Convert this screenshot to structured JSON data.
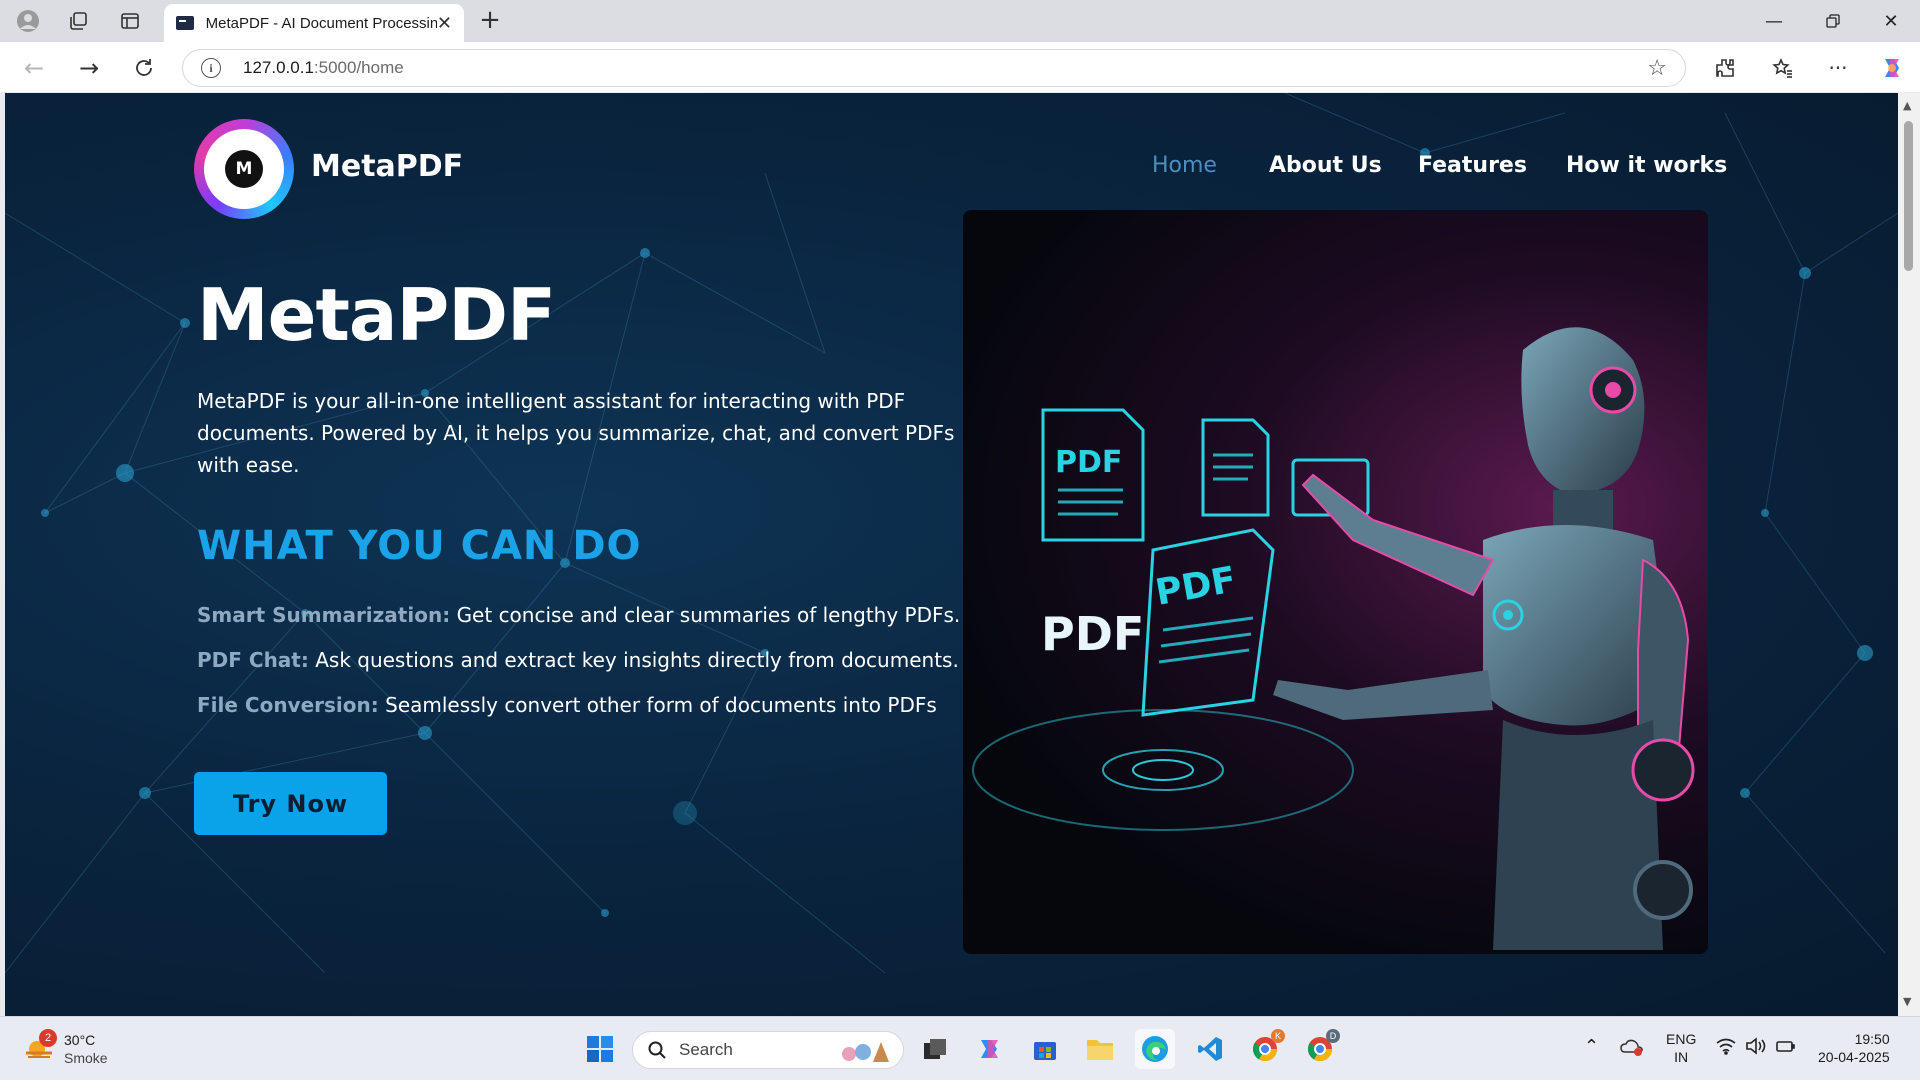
{
  "browser": {
    "tab_title": "MetaPDF - AI Document Processing",
    "url_host": "127.0.0.1",
    "url_path": ":5000/home"
  },
  "site": {
    "brand": "MetaPDF",
    "logo_letter": "M",
    "nav": [
      {
        "label": "Home",
        "active": true
      },
      {
        "label": "About Us",
        "active": false
      },
      {
        "label": "Features",
        "active": false
      },
      {
        "label": "How it works",
        "active": false
      }
    ],
    "hero_title": "MetaPDF",
    "hero_description": "MetaPDF is your all-in-one intelligent assistant for interacting with PDF documents. Powered by AI, it helps you summarize, chat, and convert PDFs with ease.",
    "section_heading": "WHAT YOU CAN DO",
    "features": [
      {
        "label": "Smart Summarization:",
        "text": "Get concise and clear summaries of lengthy PDFs."
      },
      {
        "label": "PDF Chat:",
        "text": "Ask questions and extract key insights directly from documents."
      },
      {
        "label": "File Conversion:",
        "text": "Seamlessly convert other form of documents into PDFs"
      }
    ],
    "cta_label": "Try Now",
    "image_labels": [
      "PDF",
      "PDF",
      "PDF"
    ],
    "colors": {
      "accent": "#0aa3ea",
      "heading": "#1aa3e8",
      "background": "#0a2540"
    }
  },
  "taskbar": {
    "weather_badge": "2",
    "temperature": "30°C",
    "condition": "Smoke",
    "search_placeholder": "Search",
    "lang_1": "ENG",
    "lang_2": "IN",
    "time": "19:50",
    "date": "20-04-2025",
    "chrome_badge_1": "K",
    "chrome_badge_2": "D"
  }
}
